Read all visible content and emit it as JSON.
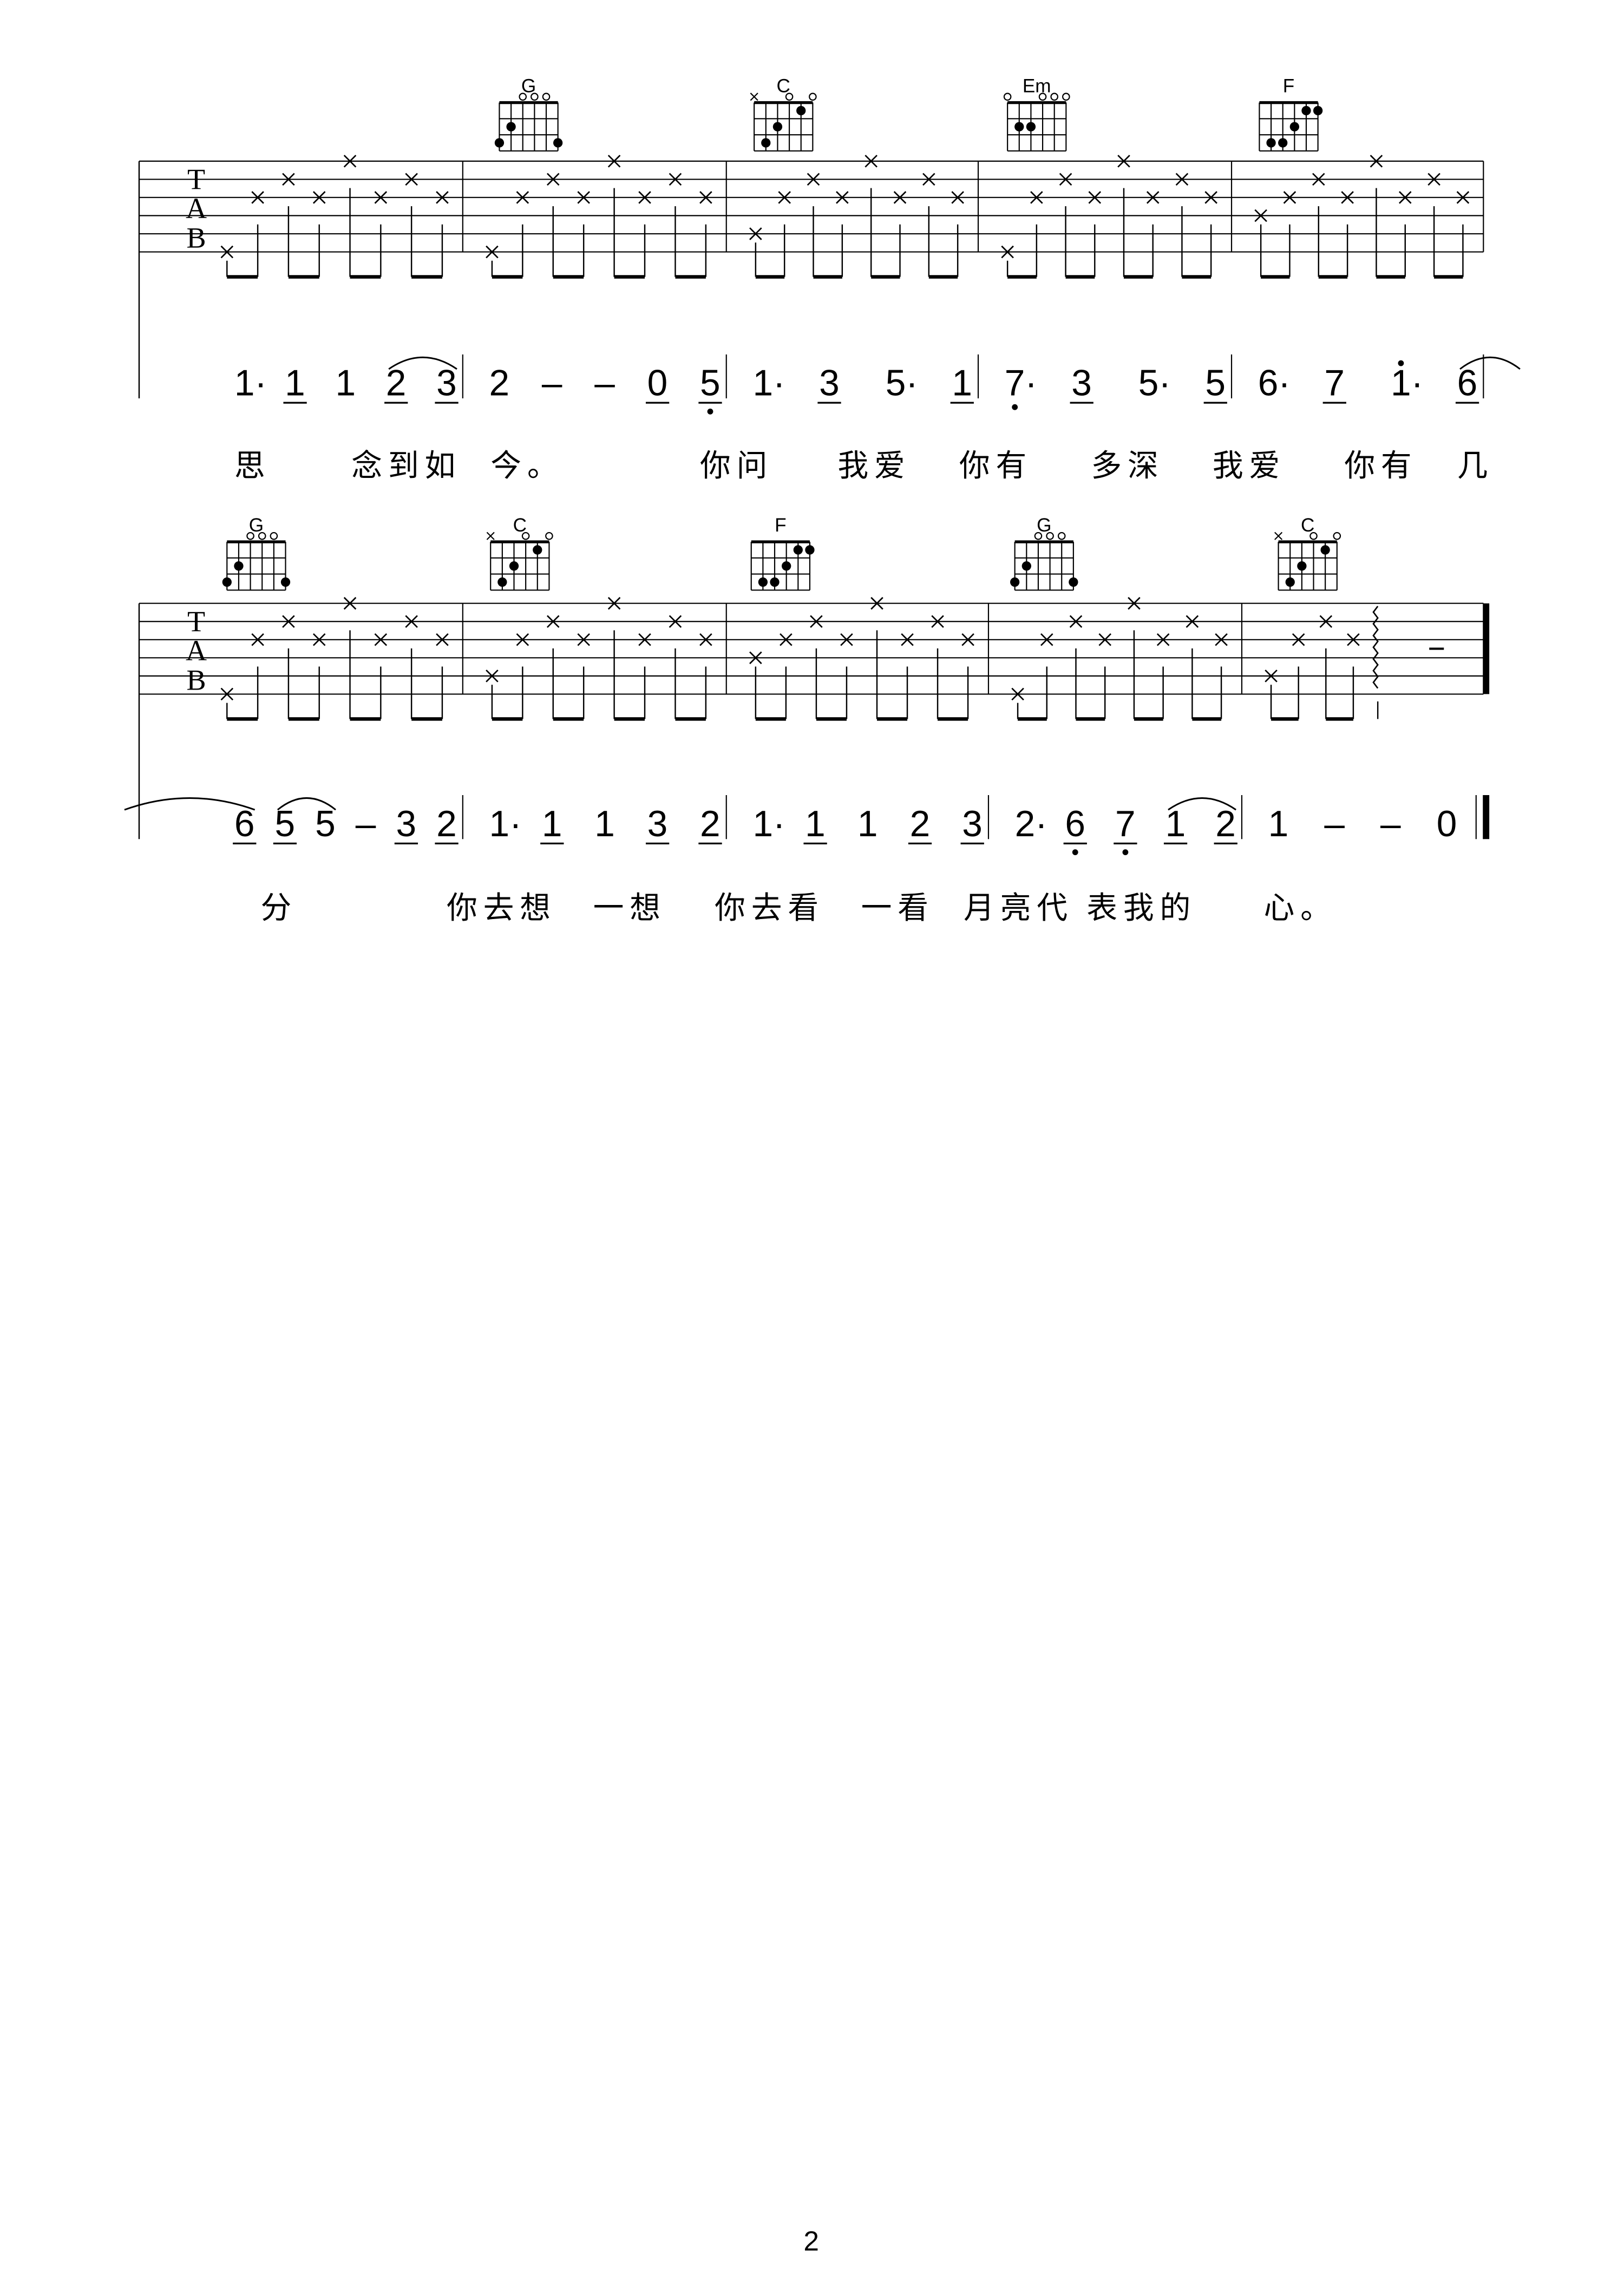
{
  "page_number": "2",
  "tab_clef": [
    "T",
    "A",
    "B"
  ],
  "systems": [
    {
      "chords": [
        {
          "name": "G",
          "open": [
            4,
            3,
            2
          ],
          "muted": [],
          "dots": [
            [
              5,
              2
            ],
            [
              6,
              3
            ],
            [
              1,
              3
            ]
          ]
        },
        {
          "name": "C",
          "open": [
            3,
            1
          ],
          "muted": [
            6
          ],
          "dots": [
            [
              5,
              3
            ],
            [
              4,
              2
            ],
            [
              2,
              1
            ]
          ]
        },
        {
          "name": "Em",
          "open": [
            6,
            3,
            2,
            1
          ],
          "muted": [],
          "dots": [
            [
              5,
              2
            ],
            [
              4,
              2
            ]
          ]
        },
        {
          "name": "F",
          "open": [],
          "muted": [],
          "dots": [
            [
              2,
              1
            ],
            [
              1,
              1
            ],
            [
              3,
              2
            ],
            [
              5,
              3
            ],
            [
              4,
              3
            ]
          ]
        }
      ],
      "bass_strings": [
        6,
        6,
        5,
        6,
        4
      ],
      "notation": [
        {
          "tokens": [
            {
              "t": "1·"
            },
            {
              "t": "1",
              "u": 1
            },
            {
              "t": "1"
            },
            {
              "t": "2",
              "u": 1
            },
            {
              "t": "3",
              "u": 1
            }
          ],
          "ties": [
            [
              3,
              4
            ]
          ]
        },
        {
          "tokens": [
            {
              "t": "2"
            },
            {
              "t": "–"
            },
            {
              "t": "–"
            },
            {
              "t": "0",
              "u": 1
            },
            {
              "t": "5",
              "u": 1,
              "below": 1
            }
          ],
          "ties": []
        },
        {
          "tokens": [
            {
              "t": "1·"
            },
            {
              "t": "3",
              "u": 1
            },
            {
              "t": "5·"
            },
            {
              "t": "1",
              "u": 1
            }
          ],
          "ties": []
        },
        {
          "tokens": [
            {
              "t": "7·",
              "below": 1
            },
            {
              "t": "3",
              "u": 1
            },
            {
              "t": "5·"
            },
            {
              "t": "5",
              "u": 1
            }
          ],
          "ties": []
        },
        {
          "tokens": [
            {
              "t": "6·"
            },
            {
              "t": "7",
              "u": 1
            },
            {
              "t": "1·",
              "above": 1
            },
            {
              "t": "6",
              "u": 1
            }
          ],
          "ties": [
            [
              3,
              "end"
            ]
          ]
        }
      ],
      "lyrics": [
        "思",
        "念到如",
        "今。",
        "你问",
        "我爱",
        "你有",
        "多深",
        "我爱",
        "你有",
        "几"
      ]
    },
    {
      "chords": [
        {
          "name": "G",
          "open": [
            4,
            3,
            2
          ],
          "muted": [],
          "dots": [
            [
              5,
              2
            ],
            [
              6,
              3
            ],
            [
              1,
              3
            ]
          ]
        },
        {
          "name": "C",
          "open": [
            3,
            1
          ],
          "muted": [
            6
          ],
          "dots": [
            [
              5,
              3
            ],
            [
              4,
              2
            ],
            [
              2,
              1
            ]
          ]
        },
        {
          "name": "F",
          "open": [],
          "muted": [],
          "dots": [
            [
              2,
              1
            ],
            [
              1,
              1
            ],
            [
              3,
              2
            ],
            [
              5,
              3
            ],
            [
              4,
              3
            ]
          ]
        },
        {
          "name": "G",
          "open": [
            4,
            3,
            2
          ],
          "muted": [],
          "dots": [
            [
              5,
              2
            ],
            [
              6,
              3
            ],
            [
              1,
              3
            ]
          ]
        },
        {
          "name": "C",
          "open": [
            3,
            1
          ],
          "muted": [
            6
          ],
          "dots": [
            [
              5,
              3
            ],
            [
              4,
              2
            ],
            [
              2,
              1
            ]
          ]
        }
      ],
      "bass_strings": [
        6,
        5,
        4,
        6,
        5
      ],
      "notation": [
        {
          "tokens": [
            {
              "t": "6",
              "u": 1
            },
            {
              "t": "5",
              "u": 1
            },
            {
              "t": "5"
            },
            {
              "t": "–"
            },
            {
              "t": "3",
              "u": 1
            },
            {
              "t": "2",
              "u": 1
            }
          ],
          "ties": [
            [
              "start",
              0
            ],
            [
              1,
              2
            ]
          ]
        },
        {
          "tokens": [
            {
              "t": "1·"
            },
            {
              "t": "1",
              "u": 1
            },
            {
              "t": "1"
            },
            {
              "t": "3",
              "u": 1
            },
            {
              "t": "2",
              "u": 1
            }
          ],
          "ties": []
        },
        {
          "tokens": [
            {
              "t": "1·"
            },
            {
              "t": "1",
              "u": 1
            },
            {
              "t": "1"
            },
            {
              "t": "2",
              "u": 1
            },
            {
              "t": "3",
              "u": 1
            }
          ],
          "ties": []
        },
        {
          "tokens": [
            {
              "t": "2·"
            },
            {
              "t": "6",
              "u": 1,
              "below": 1
            },
            {
              "t": "7",
              "u": 1,
              "below": 1
            },
            {
              "t": "1",
              "u": 1
            },
            {
              "t": "2",
              "u": 1
            }
          ],
          "ties": [
            [
              3,
              4
            ]
          ]
        },
        {
          "tokens": [
            {
              "t": "1"
            },
            {
              "t": "–"
            },
            {
              "t": "–"
            },
            {
              "t": "0"
            }
          ],
          "ties": []
        }
      ],
      "lyrics": [
        "分",
        "你去想",
        "一想",
        "你去看",
        "一看",
        "月亮代",
        "表我的",
        "心。"
      ]
    }
  ]
}
